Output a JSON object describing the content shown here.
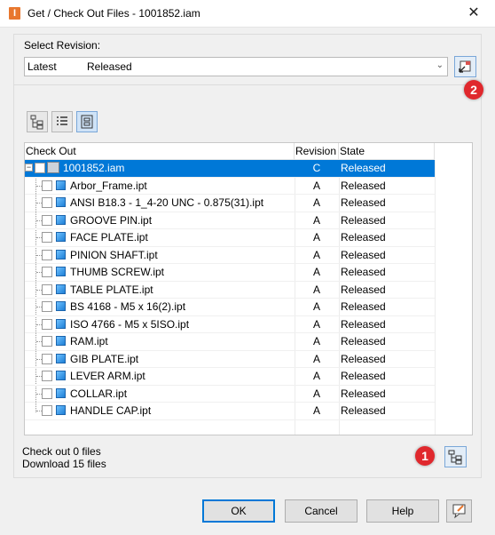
{
  "window": {
    "title": "Get / Check Out Files - 1001852.iam",
    "close_glyph": "✕"
  },
  "revision": {
    "label": "Select Revision:",
    "selected_name": "Latest",
    "selected_state": "Released"
  },
  "tree": {
    "columns": [
      "Check Out",
      "Revision",
      "State"
    ],
    "rows": [
      {
        "name": "1001852.iam",
        "revision": "C",
        "state": "Released"
      },
      {
        "name": "Arbor_Frame.ipt",
        "revision": "A",
        "state": "Released"
      },
      {
        "name": "ANSI B18.3 - 1_4-20 UNC - 0.875(31).ipt",
        "revision": "A",
        "state": "Released"
      },
      {
        "name": "GROOVE PIN.ipt",
        "revision": "A",
        "state": "Released"
      },
      {
        "name": "FACE PLATE.ipt",
        "revision": "A",
        "state": "Released"
      },
      {
        "name": "PINION SHAFT.ipt",
        "revision": "A",
        "state": "Released"
      },
      {
        "name": "THUMB SCREW.ipt",
        "revision": "A",
        "state": "Released"
      },
      {
        "name": "TABLE PLATE.ipt",
        "revision": "A",
        "state": "Released"
      },
      {
        "name": "BS 4168 - M5 x 16(2).ipt",
        "revision": "A",
        "state": "Released"
      },
      {
        "name": "ISO 4766 - M5 x 5ISO.ipt",
        "revision": "A",
        "state": "Released"
      },
      {
        "name": "RAM.ipt",
        "revision": "A",
        "state": "Released"
      },
      {
        "name": "GIB PLATE.ipt",
        "revision": "A",
        "state": "Released"
      },
      {
        "name": "LEVER ARM.ipt",
        "revision": "A",
        "state": "Released"
      },
      {
        "name": "COLLAR.ipt",
        "revision": "A",
        "state": "Released"
      },
      {
        "name": "HANDLE CAP.ipt",
        "revision": "A",
        "state": "Released"
      }
    ]
  },
  "status": {
    "checkout": "Check out 0 files",
    "download": "Download 15 files"
  },
  "badges": {
    "one": "1",
    "two": "2"
  },
  "buttons": {
    "ok": "OK",
    "cancel": "Cancel",
    "help": "Help"
  },
  "colors": {
    "selection": "#0078d7",
    "badge": "#e0282d",
    "part_icon": "#1e7fd6"
  }
}
